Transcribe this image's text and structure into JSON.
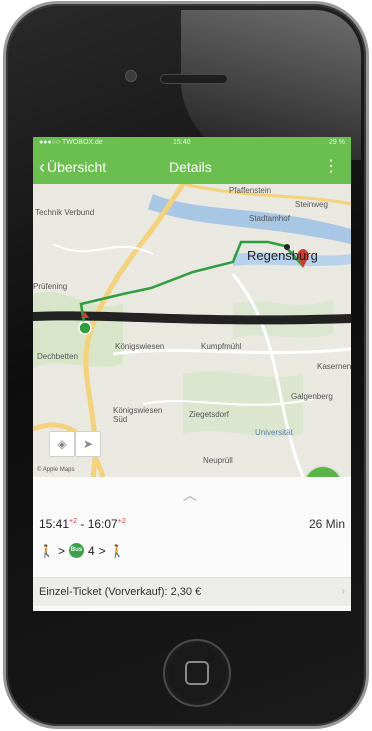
{
  "status_bar": {
    "carrier": "●●●○○ TWOBOX.de",
    "time": "15:40",
    "battery": "29 %"
  },
  "nav": {
    "back_label": "Übersicht",
    "title": "Details",
    "menu_icon": "more-vertical-icon"
  },
  "map": {
    "labels": {
      "top_left": "Technik\nVerbund",
      "pfaffenstein": "Pfaffenstein",
      "steinweg": "Steinweg",
      "stadtamhof": "Stadtamhof",
      "city": "Regensburg",
      "west_district": "Königswiesen",
      "kumpfmuhl": "Kumpfmühl",
      "dechbetten": "Dechbetten",
      "kasernenviertel": "Kasernen",
      "galgenberg": "Galgenberg",
      "koenigswiesen_sued": "Königswiesen\nSüd",
      "ziegetsdorf": "Ziegetsdorf",
      "universitaet": "Universität",
      "neuprull": "Neuprüll",
      "prufening": "Prüfening",
      "attribution": "© Apple Maps"
    },
    "buttons": {
      "layers_icon": "map-layers-icon",
      "locate_icon": "location-arrow-icon"
    }
  },
  "fab": {
    "icon": "share-icon"
  },
  "journey": {
    "dep_time": "15:41",
    "dep_delay": "+2",
    "arr_time": "16:07",
    "arr_delay": "+2",
    "duration": "26 Min",
    "bus_line": "4",
    "bus_badge": "Bus"
  },
  "ticket": {
    "label": "Einzel-Ticket (Vorverkauf): 2,30 €"
  },
  "colors": {
    "accent": "#6bbf4f",
    "route": "#2e9e3e",
    "marker": "#d33a2c"
  }
}
